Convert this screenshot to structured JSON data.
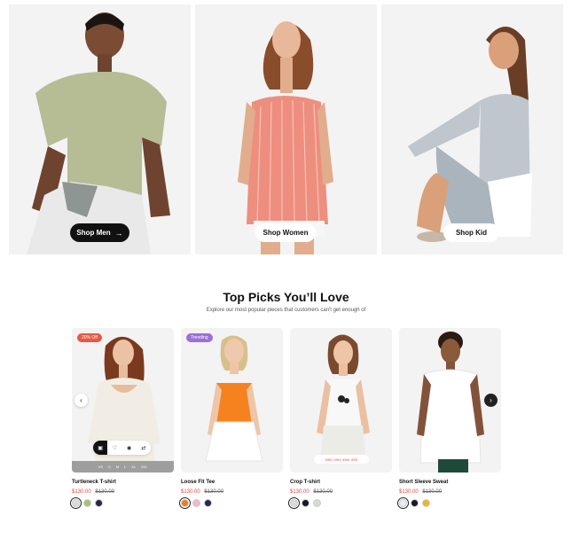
{
  "hero": {
    "men": {
      "label": "Shop Men",
      "arrow": "→"
    },
    "women": {
      "label": "Shop Women"
    },
    "kid": {
      "label": "Shop Kid"
    }
  },
  "section": {
    "title": "Top Picks You’ll Love",
    "subtitle": "Explore our most popular pieces that customers can't get enough of"
  },
  "products": [
    {
      "name": "Turtleneck T-shirt",
      "price": "$130.00",
      "old_price": "$130.00",
      "badge": "20% Off",
      "sizes": [
        "XS",
        "S",
        "M",
        "L",
        "XL",
        "2XL"
      ],
      "swatches": [
        "#dcdcdc",
        "#a9c46a",
        "#1f2a44"
      ]
    },
    {
      "name": "Loose Fit Tee",
      "price": "$130.00",
      "old_price": "$130.00",
      "badge": "Trending",
      "swatches": [
        "#f07b1e",
        "#f2b8c6",
        "#1f2a5a"
      ]
    },
    {
      "name": "Crop T-shirt",
      "price": "$130.00",
      "old_price": "$130.00",
      "countdown": "09D: 09H: 09M: 09S",
      "swatches": [
        "#dcdcdc",
        "#151a2a",
        "#d8d8d8"
      ]
    },
    {
      "name": "Short Sleeve Sweat",
      "price": "$130.00",
      "old_price": "$130.00",
      "swatches": [
        "#ececf4",
        "#151a2a",
        "#f0b52a"
      ]
    }
  ],
  "icons": {
    "bag": "bag-icon",
    "heart": "heart-icon",
    "eye": "eye-icon",
    "compare": "compare-icon",
    "prev": "‹",
    "next": "›"
  },
  "colors": {
    "sale_red": "#e5483a",
    "trend_purple": "#9b6fd9",
    "dark": "#111111"
  }
}
